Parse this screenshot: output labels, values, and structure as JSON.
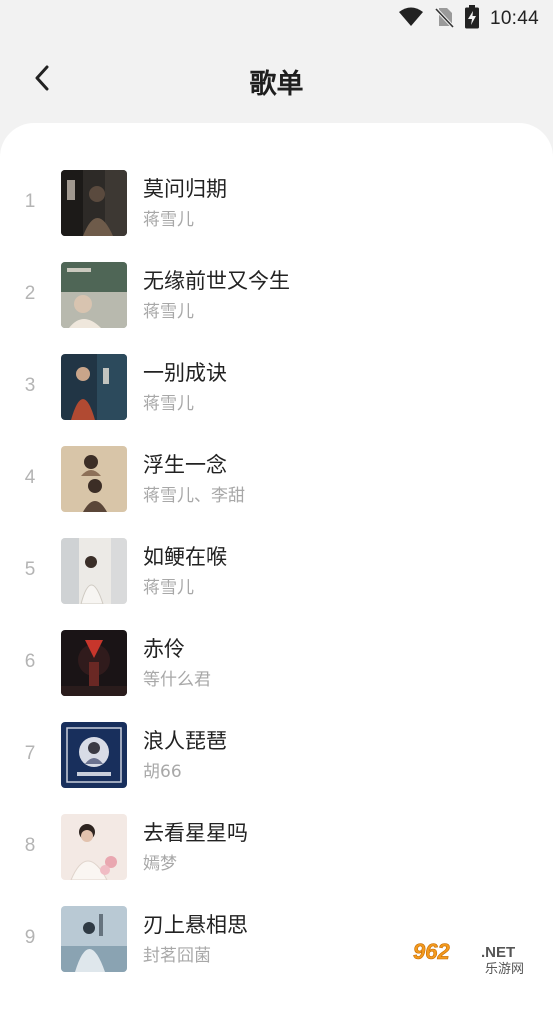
{
  "status_bar": {
    "time": "10:44",
    "icons": [
      "wifi-icon",
      "no-sim-icon",
      "battery-charging-icon"
    ]
  },
  "header": {
    "back_icon": "chevron-left-icon",
    "title": "歌单"
  },
  "songs": [
    {
      "index": "1",
      "title": "莫问归期",
      "artist": "蒋雪儿"
    },
    {
      "index": "2",
      "title": "无缘前世又今生",
      "artist": "蒋雪儿"
    },
    {
      "index": "3",
      "title": "一别成诀",
      "artist": "蒋雪儿"
    },
    {
      "index": "4",
      "title": "浮生一念",
      "artist": "蒋雪儿、李甜"
    },
    {
      "index": "5",
      "title": "如鲠在喉",
      "artist": "蒋雪儿"
    },
    {
      "index": "6",
      "title": "赤伶",
      "artist": "等什么君"
    },
    {
      "index": "7",
      "title": "浪人琵琶",
      "artist": "胡66"
    },
    {
      "index": "8",
      "title": "去看星星吗",
      "artist": "嫣梦"
    },
    {
      "index": "9",
      "title": "刃上悬相思",
      "artist": "封茗囧菌"
    }
  ],
  "watermark": {
    "number": "962",
    "suffix": ".NET",
    "site": "乐游网"
  }
}
